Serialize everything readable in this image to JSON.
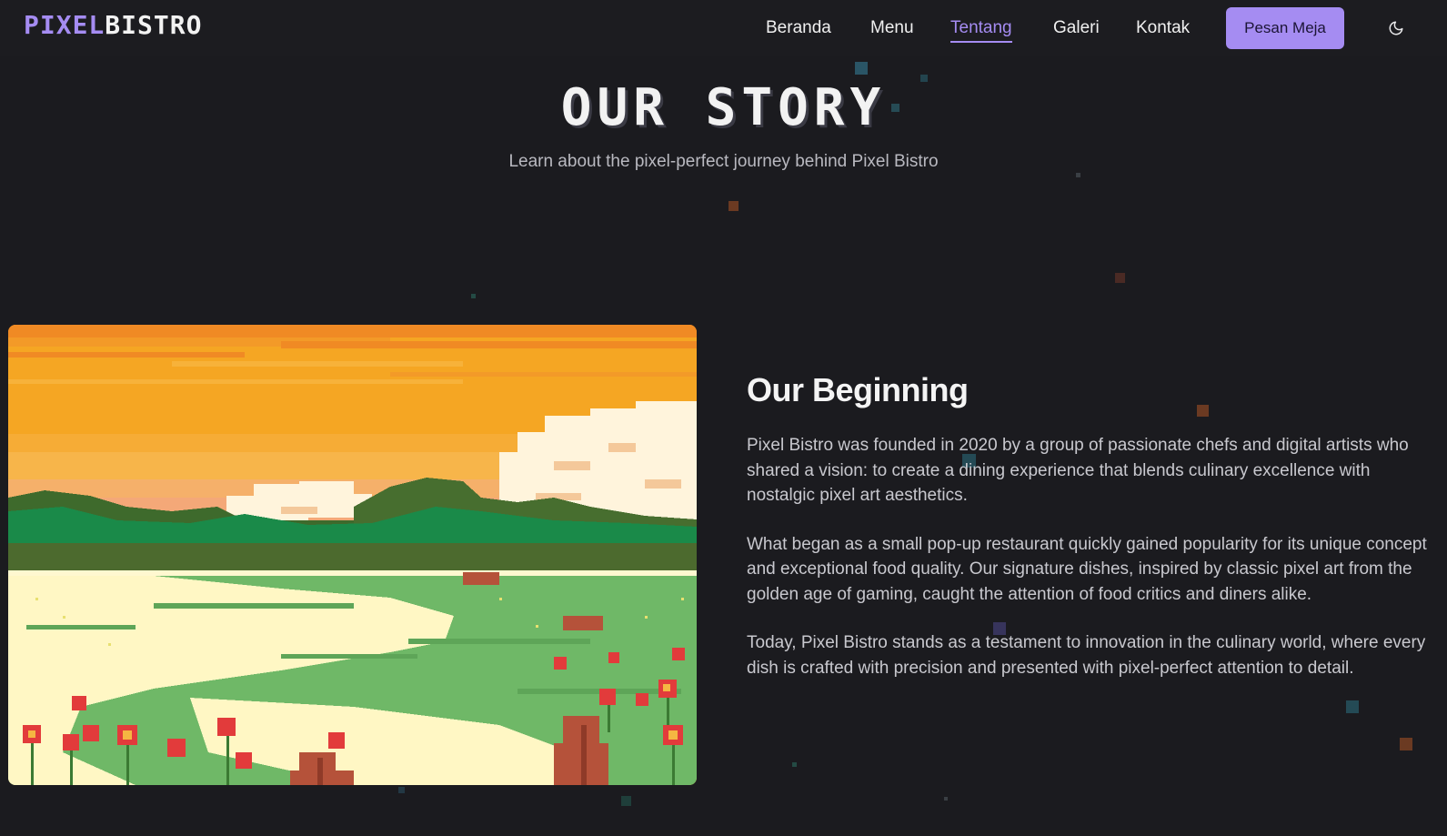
{
  "brand": {
    "part1": "PIXEL",
    "part2": "BISTRO"
  },
  "nav": {
    "items": [
      {
        "label": "Beranda",
        "active": false
      },
      {
        "label": "Menu",
        "active": false
      },
      {
        "label": "Tentang",
        "active": true
      },
      {
        "label": "Galeri",
        "active": false
      },
      {
        "label": "Kontak",
        "active": false
      }
    ],
    "cta_label": "Pesan Meja",
    "theme_icon": "moon-icon"
  },
  "hero": {
    "title": "OUR STORY",
    "subtitle": "Learn about the pixel-perfect journey behind Pixel Bistro"
  },
  "about": {
    "heading": "Our Beginning",
    "paragraphs": [
      "Pixel Bistro was founded in 2020 by a group of passionate chefs and digital artists who shared a vision: to create a dining experience that blends culinary excellence with nostalgic pixel art aesthetics.",
      "What began as a small pop-up restaurant quickly gained popularity for its unique concept and exceptional food quality. Our signature dishes, inspired by classic pixel art from the golden age of gaming, caught the attention of food critics and diners alike.",
      "Today, Pixel Bistro stands as a testament to innovation in the culinary world, where every dish is crafted with precision and presented with pixel-perfect attention to detail."
    ]
  },
  "colors": {
    "accent": "#a58cf2",
    "background": "#1b1b1f",
    "header_bg": "#1c1c20"
  }
}
